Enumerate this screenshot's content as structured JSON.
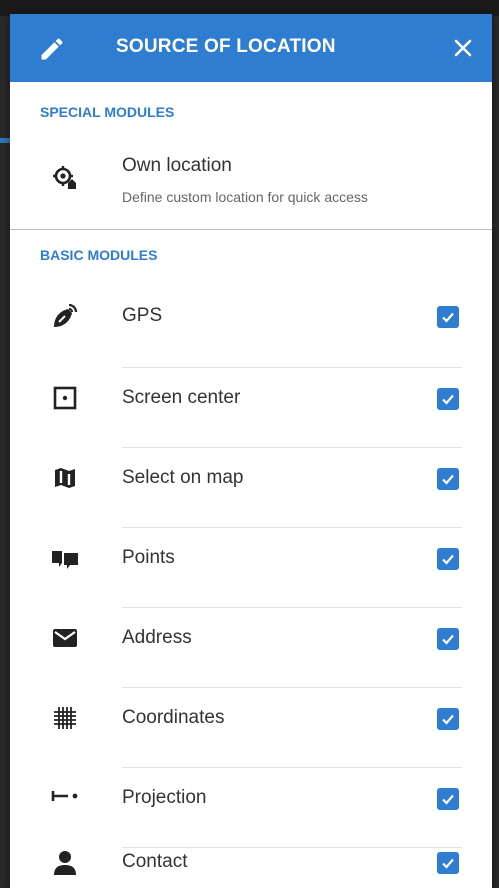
{
  "dialog": {
    "title": "SOURCE OF LOCATION",
    "accent_color": "#2f7dd1",
    "edit_icon": "pencil-icon",
    "close_icon": "close-icon"
  },
  "special_section": {
    "title": "SPECIAL MODULES",
    "items": [
      {
        "label": "Own location",
        "sublabel": "Define custom location for quick access",
        "icon": "own-location-icon"
      }
    ]
  },
  "basic_section": {
    "title": "BASIC MODULES",
    "items": [
      {
        "label": "GPS",
        "icon": "satellite-icon",
        "checked": true
      },
      {
        "label": "Screen center",
        "icon": "screen-center-icon",
        "checked": true
      },
      {
        "label": "Select on map",
        "icon": "map-icon",
        "checked": true
      },
      {
        "label": "Points",
        "icon": "points-icon",
        "checked": true
      },
      {
        "label": "Address",
        "icon": "envelope-icon",
        "checked": true
      },
      {
        "label": "Coordinates",
        "icon": "grid-icon",
        "checked": true
      },
      {
        "label": "Projection",
        "icon": "projection-icon",
        "checked": true
      },
      {
        "label": "Contact",
        "icon": "person-icon",
        "checked": true
      }
    ]
  }
}
